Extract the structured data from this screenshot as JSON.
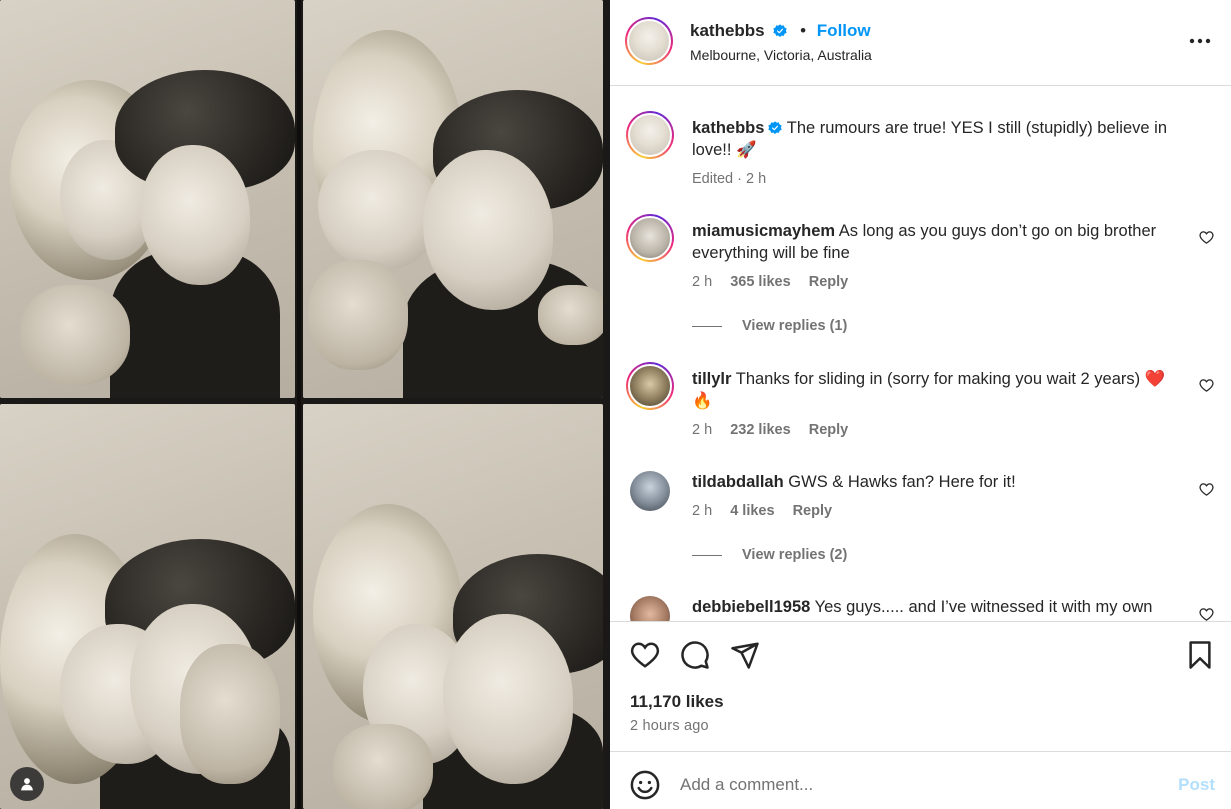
{
  "post": {
    "author": "kathebbs",
    "verified": true,
    "separator": "•",
    "follow_label": "Follow",
    "location": "Melbourne, Victoria, Australia",
    "more_icon": "more-horizontal-icon",
    "image_alt_description_icon": "photo-booth-strip-image"
  },
  "caption": {
    "author": "kathebbs",
    "text": "The rumours are true! YES I still (stupidly) believe in love!! 🚀",
    "edited": "Edited · 2 h"
  },
  "comments": [
    {
      "author": "miamusicmayhem",
      "text": "As long as you guys don’t go on big brother everything will be fine",
      "time": "2 h",
      "likes": "365 likes",
      "reply": "Reply",
      "view_replies": "View replies (1)"
    },
    {
      "author": "tillylr",
      "text": "Thanks for sliding in (sorry for making you wait 2 years) ❤️🔥",
      "time": "2 h",
      "likes": "232 likes",
      "reply": "Reply"
    },
    {
      "author": "tildabdallah",
      "text": "GWS & Hawks fan? Here for it!",
      "time": "2 h",
      "likes": "4 likes",
      "reply": "Reply",
      "view_replies": "View replies (2)"
    },
    {
      "author": "debbiebell1958",
      "text": "Yes guys..... and I’ve witnessed it with my own"
    }
  ],
  "actions": {
    "like_icon": "heart-icon",
    "comment_icon": "comment-icon",
    "share_icon": "send-icon",
    "save_icon": "bookmark-icon",
    "likes": "11,170 likes",
    "time": "2 hours ago"
  },
  "add_comment": {
    "placeholder": "Add a comment...",
    "post_label": "Post",
    "emoji_icon": "emoji-icon"
  },
  "colors": {
    "accent": "#0095f6",
    "post_disabled": "#b2dffc",
    "meta": "#737373",
    "text": "#262626"
  }
}
